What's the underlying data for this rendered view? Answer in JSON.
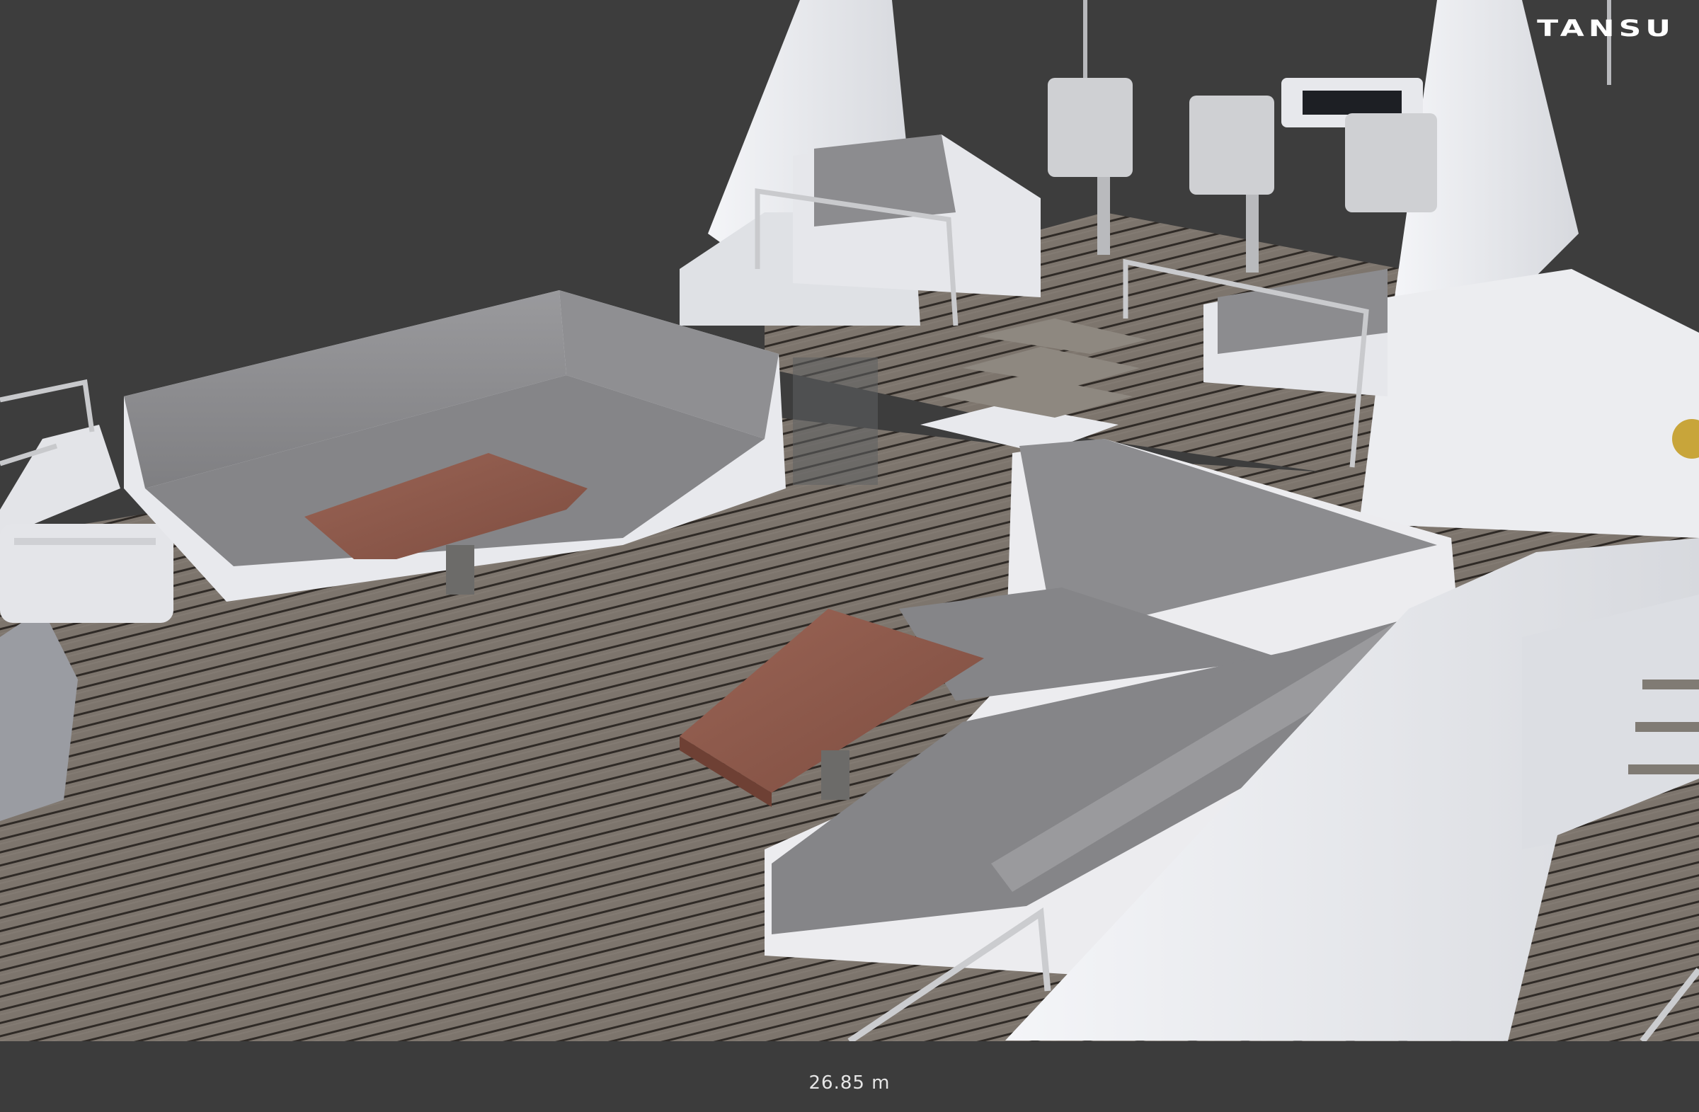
{
  "brand": {
    "logo_text": "TANSU"
  },
  "viewer": {
    "scene": "yacht-flybridge-deck-render"
  },
  "footer": {
    "measurement": "26.85 m"
  },
  "colors": {
    "background": "#3d3d3d",
    "deck": "#7b736b",
    "cushion": "#8a8a8c",
    "hull": "#e9eaee",
    "table": "#8e5a4c"
  }
}
